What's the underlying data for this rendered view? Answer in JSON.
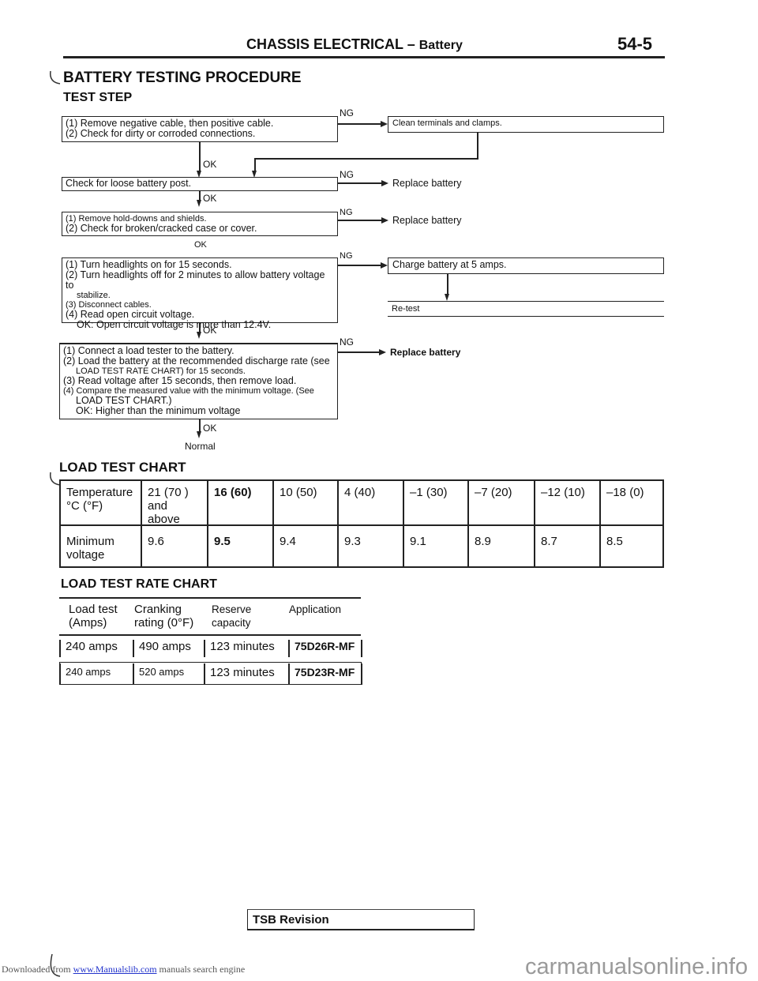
{
  "header": {
    "section": "CHASSIS ELECTRICAL",
    "dash": "–",
    "subsection": "Battery",
    "page_number": "54-5"
  },
  "title": "BATTERY TESTING PROCEDURE",
  "test_step_label": "TEST STEP",
  "flow": {
    "step1": {
      "lines": [
        "(1) Remove negative cable, then positive cable.",
        "(2) Check for dirty or corroded connections."
      ],
      "ng": "NG",
      "ng_action": "Clean terminals and clamps.",
      "ok": "OK"
    },
    "step2": {
      "lines": [
        "Check for loose battery post."
      ],
      "ng": "NG",
      "ng_action": "Replace battery",
      "ok": "OK"
    },
    "step3": {
      "lines": [
        "(1) Remove hold-downs and shields.",
        "(2) Check for broken/cracked case or cover."
      ],
      "ng": "NG",
      "ng_action": "Replace battery",
      "ok": "OK"
    },
    "step4": {
      "lines": [
        "(1) Turn headlights on for 15 seconds.",
        "(2) Turn headlights off for 2 minutes to allow battery voltage to",
        "stabilize.",
        "(3) Disconnect cables.",
        "(4) Read open circuit voltage.",
        "OK: Open circuit voltage is more than 12.4V."
      ],
      "ng": "NG",
      "ng_action": "Charge battery at 5 amps.",
      "ng_action2": "Re-test",
      "ok": "OK"
    },
    "step5": {
      "lines": [
        "(1) Connect a load tester to the battery.",
        "(2) Load the battery at the recommended discharge rate (see",
        "LOAD TEST RATE CHART) for 15 seconds.",
        "(3) Read voltage after 15 seconds, then remove load.",
        "(4) Compare the measured value with the minimum voltage. (See",
        "LOAD TEST CHART.)",
        "OK: Higher than the minimum voltage"
      ],
      "ng": "NG",
      "ng_action": "Replace battery",
      "ok": "OK"
    },
    "result": "Normal"
  },
  "load_test_chart": {
    "title": "LOAD TEST CHART",
    "row_headers": [
      "Temperature\n°C (°F)",
      "Minimum\nvoltage"
    ],
    "temperatures": [
      "21 (70 )\nand\nabove",
      "16 (60)",
      "10 (50)",
      "4 (40)",
      "–1 (30)",
      "–7 (20)",
      "–12 (10)",
      "–18 (0)"
    ],
    "min_voltage": [
      "9.6",
      "9.5",
      "9.4",
      "9.3",
      "9.1",
      "8.9",
      "8.7",
      "8.5"
    ]
  },
  "load_test_rate_chart": {
    "title": "LOAD TEST RATE CHART",
    "headers": [
      "Load test\n(Amps)",
      "Cranking\nrating (0°F)",
      "Reserve\ncapacity",
      "Application"
    ],
    "rows": [
      [
        "240 amps",
        "490 amps",
        "123 minutes",
        "75D26R-MF"
      ],
      [
        "240 amps",
        "520 amps",
        "123 minutes",
        "75D23R-MF"
      ]
    ]
  },
  "footer": {
    "tsb": "TSB Revision",
    "downloaded_prefix": "Downloaded from ",
    "link": "www.Manualslib.com",
    "downloaded_suffix": " manuals search engine",
    "watermark": "carmanualsonline.info"
  }
}
